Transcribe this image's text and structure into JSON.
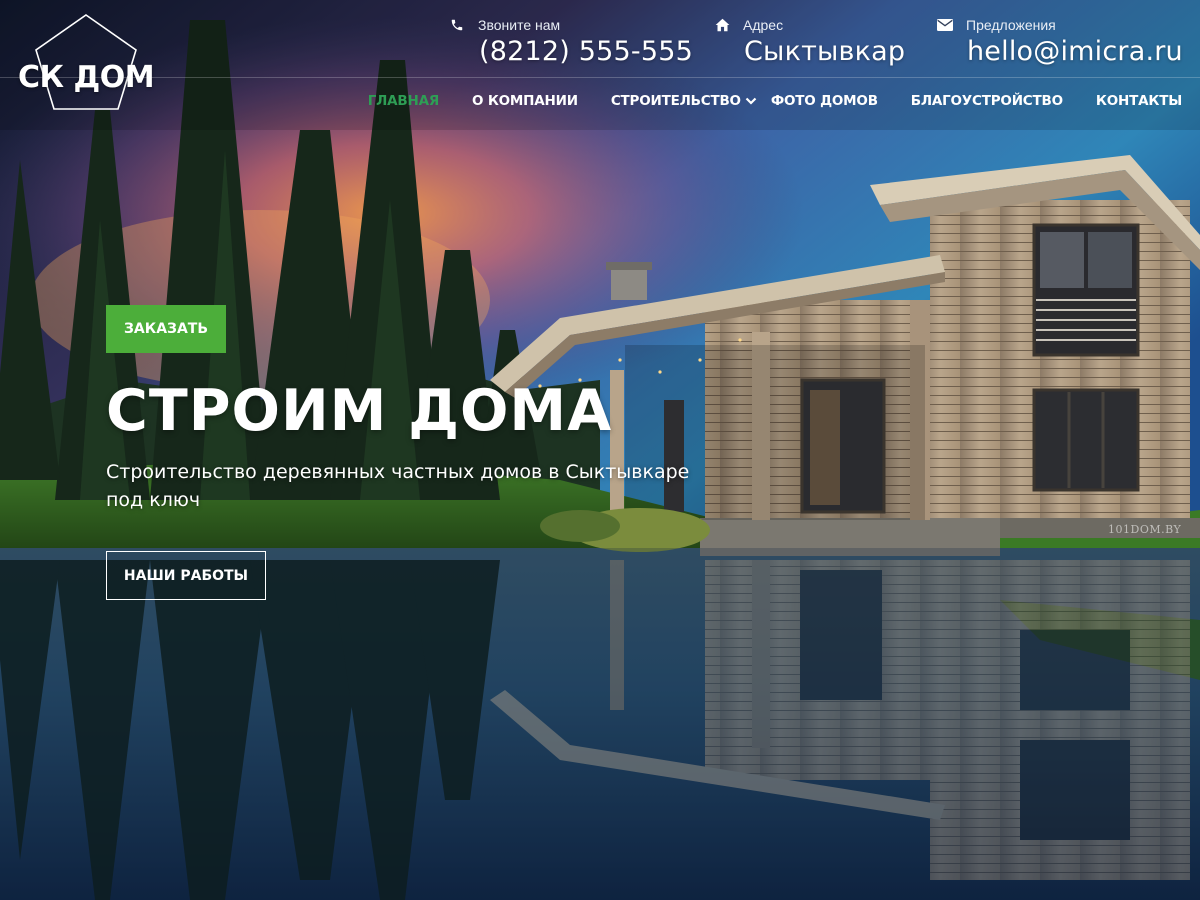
{
  "brand": {
    "logo_text": "СК ДОМ"
  },
  "contacts": {
    "phone": {
      "label": "Звоните нам",
      "value": "(8212) 555-555",
      "icon": "phone-icon"
    },
    "address": {
      "label": "Адрес",
      "value": "Сыктывкар",
      "icon": "home-icon"
    },
    "email": {
      "label": "Предложения",
      "value": "hello@imicra.ru",
      "icon": "envelope-icon"
    }
  },
  "nav": {
    "items": [
      {
        "label": "Главная",
        "active": true
      },
      {
        "label": "О компании"
      },
      {
        "label": "Строительство",
        "has_dropdown": true
      },
      {
        "label": "Фото домов"
      },
      {
        "label": "Благоустройство"
      },
      {
        "label": "Контакты"
      }
    ]
  },
  "hero": {
    "order_button": "ЗАКАЗАТЬ",
    "title": "СТРОИМ ДОМА",
    "subtitle": "Строительство деревянных частных домов в Сыктывкаре под ключ",
    "works_button": "НАШИ РАБОТЫ"
  },
  "image": {
    "watermark": "101DOM.BY"
  },
  "colors": {
    "accent_green": "#4cae3a",
    "nav_active": "#2e9e55",
    "text": "#ffffff"
  }
}
